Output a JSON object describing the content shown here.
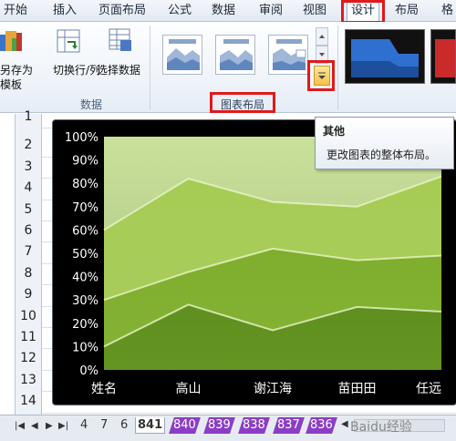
{
  "ribbon_tabs": [
    {
      "label": "开始"
    },
    {
      "label": "插入"
    },
    {
      "label": "页面布局"
    },
    {
      "label": "公式"
    },
    {
      "label": "数据"
    },
    {
      "label": "审阅"
    },
    {
      "label": "视图"
    },
    {
      "label": "设计"
    },
    {
      "label": "布局"
    },
    {
      "label": "格"
    }
  ],
  "ribbon": {
    "save_as_template_line1": "另存为",
    "save_as_template_line2": "模板",
    "switch_row_col": "切换行/列",
    "select_data": "选择数据",
    "group_data": "数据",
    "group_chart_layouts": "图表布局"
  },
  "tooltip": {
    "title": "其他",
    "description": "更改图表的整体布局。"
  },
  "row_numbers": [
    "1",
    "2",
    "3",
    "4",
    "5",
    "6",
    "7",
    "8",
    "9",
    "10",
    "11",
    "12",
    "13",
    "14"
  ],
  "chart_data": {
    "type": "area",
    "categories": [
      "姓名",
      "高山",
      "谢江海",
      "苗田田",
      "任远"
    ],
    "y_ticks": [
      "0%",
      "10%",
      "20%",
      "30%",
      "40%",
      "50%",
      "60%",
      "70%",
      "80%",
      "90%",
      "100%"
    ],
    "ylim": [
      0,
      100
    ],
    "stacked_boundaries_percent": [
      {
        "values": [
          10,
          28,
          17,
          27,
          25
        ]
      },
      {
        "values": [
          30,
          42,
          52,
          47,
          49
        ]
      },
      {
        "values": [
          60,
          82,
          72,
          70,
          83
        ]
      },
      {
        "values": [
          100,
          100,
          100,
          100,
          100
        ]
      }
    ],
    "colors": [
      "#5f8f1f",
      "#7fae2e",
      "#a6cc55",
      "#c9e19a"
    ]
  },
  "sheet_tabs": [
    {
      "label": "4"
    },
    {
      "label": "7"
    },
    {
      "label": "6"
    },
    {
      "label": "841"
    },
    {
      "label": "840"
    },
    {
      "label": "839"
    },
    {
      "label": "838"
    },
    {
      "label": "837"
    },
    {
      "label": "836"
    }
  ],
  "watermark": "Baidu经验"
}
